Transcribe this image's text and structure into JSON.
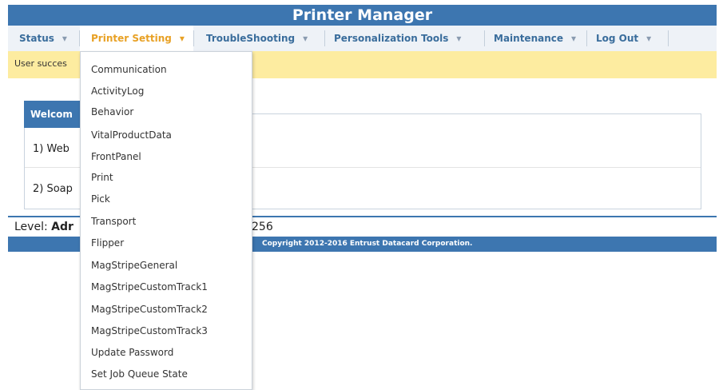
{
  "app": {
    "title": "Printer Manager"
  },
  "nav": {
    "items": [
      {
        "label": "Status",
        "caret": "▾"
      },
      {
        "label": "Printer Setting",
        "caret": "▾"
      },
      {
        "label": "TroubleShooting",
        "caret": "▾"
      },
      {
        "label": "Personalization Tools",
        "caret": "▾"
      },
      {
        "label": "Maintenance",
        "caret": "▾"
      },
      {
        "label": "Log Out",
        "caret": "▾"
      }
    ],
    "active": "Printer Setting"
  },
  "message": {
    "text": "User succes"
  },
  "panel": {
    "heading": "Welcom",
    "rows": [
      {
        "text": "1) Web"
      },
      {
        "text": "2) Soap"
      }
    ]
  },
  "status": {
    "level_label": "Level:",
    "level_value": "Adr",
    "number": "256"
  },
  "footer": {
    "copyright": "Copyright 2012-2016 Entrust Datacard Corporation."
  },
  "dropdown": {
    "items": [
      "Communication",
      "ActivityLog",
      "Behavior",
      "VitalProductData",
      "FrontPanel",
      "Print",
      "Pick",
      "Transport",
      "Flipper",
      "MagStripeGeneral",
      "MagStripeCustomTrack1",
      "MagStripeCustomTrack2",
      "MagStripeCustomTrack3",
      "Update Password",
      "Set Job Queue State"
    ]
  },
  "colors": {
    "header_bg": "#3d76b0",
    "active_menu": "#e8a125",
    "message_bg": "#fdeca0",
    "nav_text": "#3a6d9c"
  },
  "icons": {
    "dropdown_caret": "chevron-down-icon"
  }
}
